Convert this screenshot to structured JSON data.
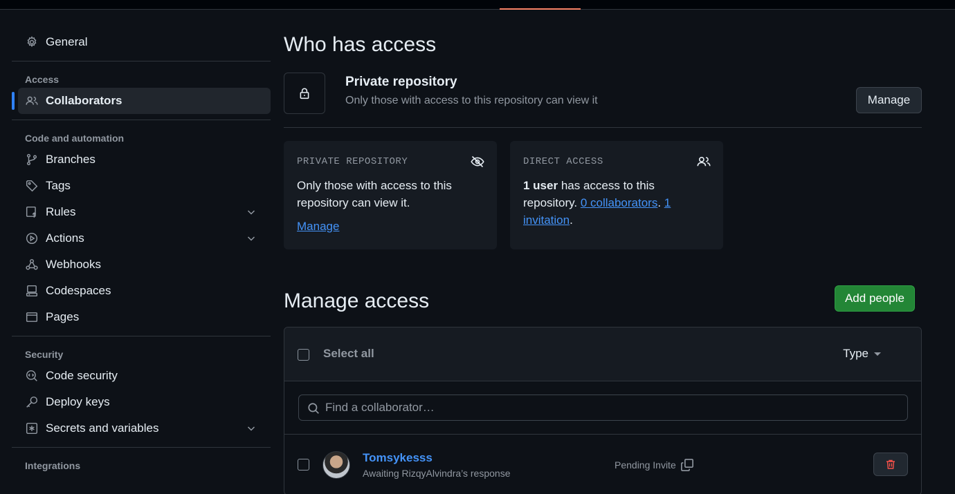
{
  "sidebar": {
    "general": "General",
    "access_heading": "Access",
    "collaborators": "Collaborators",
    "code_heading": "Code and automation",
    "branches": "Branches",
    "tags": "Tags",
    "rules": "Rules",
    "actions": "Actions",
    "webhooks": "Webhooks",
    "codespaces": "Codespaces",
    "pages": "Pages",
    "security_heading": "Security",
    "code_security": "Code security",
    "deploy_keys": "Deploy keys",
    "secrets": "Secrets and variables",
    "integrations_heading": "Integrations"
  },
  "who": {
    "title": "Who has access",
    "visibility_title": "Private repository",
    "visibility_sub": "Only those with access to this repository can view it",
    "manage_button": "Manage"
  },
  "cards": {
    "private": {
      "label": "PRIVATE REPOSITORY",
      "body": "Only those with access to this repository can view it.",
      "link": "Manage"
    },
    "direct": {
      "label": "DIRECT ACCESS",
      "count": "1 user",
      "text1": " has access to this repository. ",
      "collaborators_link": "0 collaborators",
      "sep": ". ",
      "invitation_link": "1 invitation",
      "end": "."
    }
  },
  "manage": {
    "title": "Manage access",
    "add_button": "Add people",
    "select_all": "Select all",
    "type_dropdown": "Type",
    "search_placeholder": "Find a collaborator…",
    "members": [
      {
        "name": "Tomsykesss",
        "sub": "Awaiting RizqyAlvindra’s response",
        "status": "Pending Invite"
      }
    ]
  },
  "colors": {
    "accent": "#2f81f7",
    "add_button": "#238636",
    "link": "#4493f8",
    "danger": "#f85149"
  }
}
